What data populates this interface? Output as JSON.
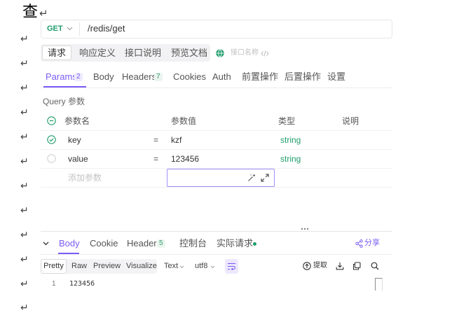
{
  "document": {
    "heading_char": "查",
    "return_mark": "↵"
  },
  "request": {
    "method": "GET",
    "url": "/redis/get"
  },
  "mode_tabs": {
    "selected": "请求",
    "items": [
      "请求",
      "响应定义",
      "接口说明",
      "预览文档"
    ]
  },
  "api_name": {
    "placeholder": "接口名称"
  },
  "param_tabs": [
    {
      "label": "Params",
      "count": "2",
      "active": true
    },
    {
      "label": "Body"
    },
    {
      "label": "Headers",
      "count": "7"
    },
    {
      "label": "Cookies"
    },
    {
      "label": "Auth"
    },
    {
      "label": "前置操作"
    },
    {
      "label": "后置操作"
    },
    {
      "label": "设置"
    }
  ],
  "query_params": {
    "title": "Query 参数",
    "columns": [
      "参数名",
      "参数值",
      "类型",
      "说明"
    ],
    "rows": [
      {
        "enabled": true,
        "name": "key",
        "operator": "=",
        "value": "kzf",
        "type": "string"
      },
      {
        "enabled": false,
        "name": "value",
        "operator": "=",
        "value": "123456",
        "type": "string"
      }
    ],
    "new_row_placeholder": "添加参数"
  },
  "response": {
    "tabs": [
      {
        "label": "Body",
        "active": true
      },
      {
        "label": "Cookie"
      },
      {
        "label": "Header",
        "count": "5"
      },
      {
        "label": "控制台"
      },
      {
        "label": "实际请求",
        "status_dot": true
      }
    ],
    "share_label": "分享",
    "view_modes": {
      "selected": "Pretty",
      "items": [
        "Pretty",
        "Raw",
        "Preview",
        "Visualize"
      ]
    },
    "format": "Text",
    "charset": "utf8",
    "extract_label": "提取",
    "lines": [
      {
        "number": "1",
        "text": "123456"
      }
    ]
  },
  "icons": {
    "method_dropdown": "chevron-down-icon",
    "api_name": "globe-icon",
    "code_toggle": "code-icon",
    "select_all": "minus-circle-icon",
    "row_enabled": "check-circle-icon",
    "row_disabled": "empty-circle-icon",
    "magic_value": "magic-wand-icon",
    "expand_editor": "expand-icon",
    "panel_resize": "drag-handle-icon",
    "collapse_response": "chevron-down-icon",
    "share": "share-icon",
    "word_wrap": "wrap-icon",
    "extract": "extract-icon",
    "download": "download-icon",
    "copy": "copy-icon",
    "search": "search-icon"
  },
  "colors": {
    "accent_purple": "#7b5cf5",
    "method_green": "#1f9d6b",
    "type_green": "#1f9d6b",
    "border": "#ececf0",
    "placeholder": "#c0c0c0"
  }
}
